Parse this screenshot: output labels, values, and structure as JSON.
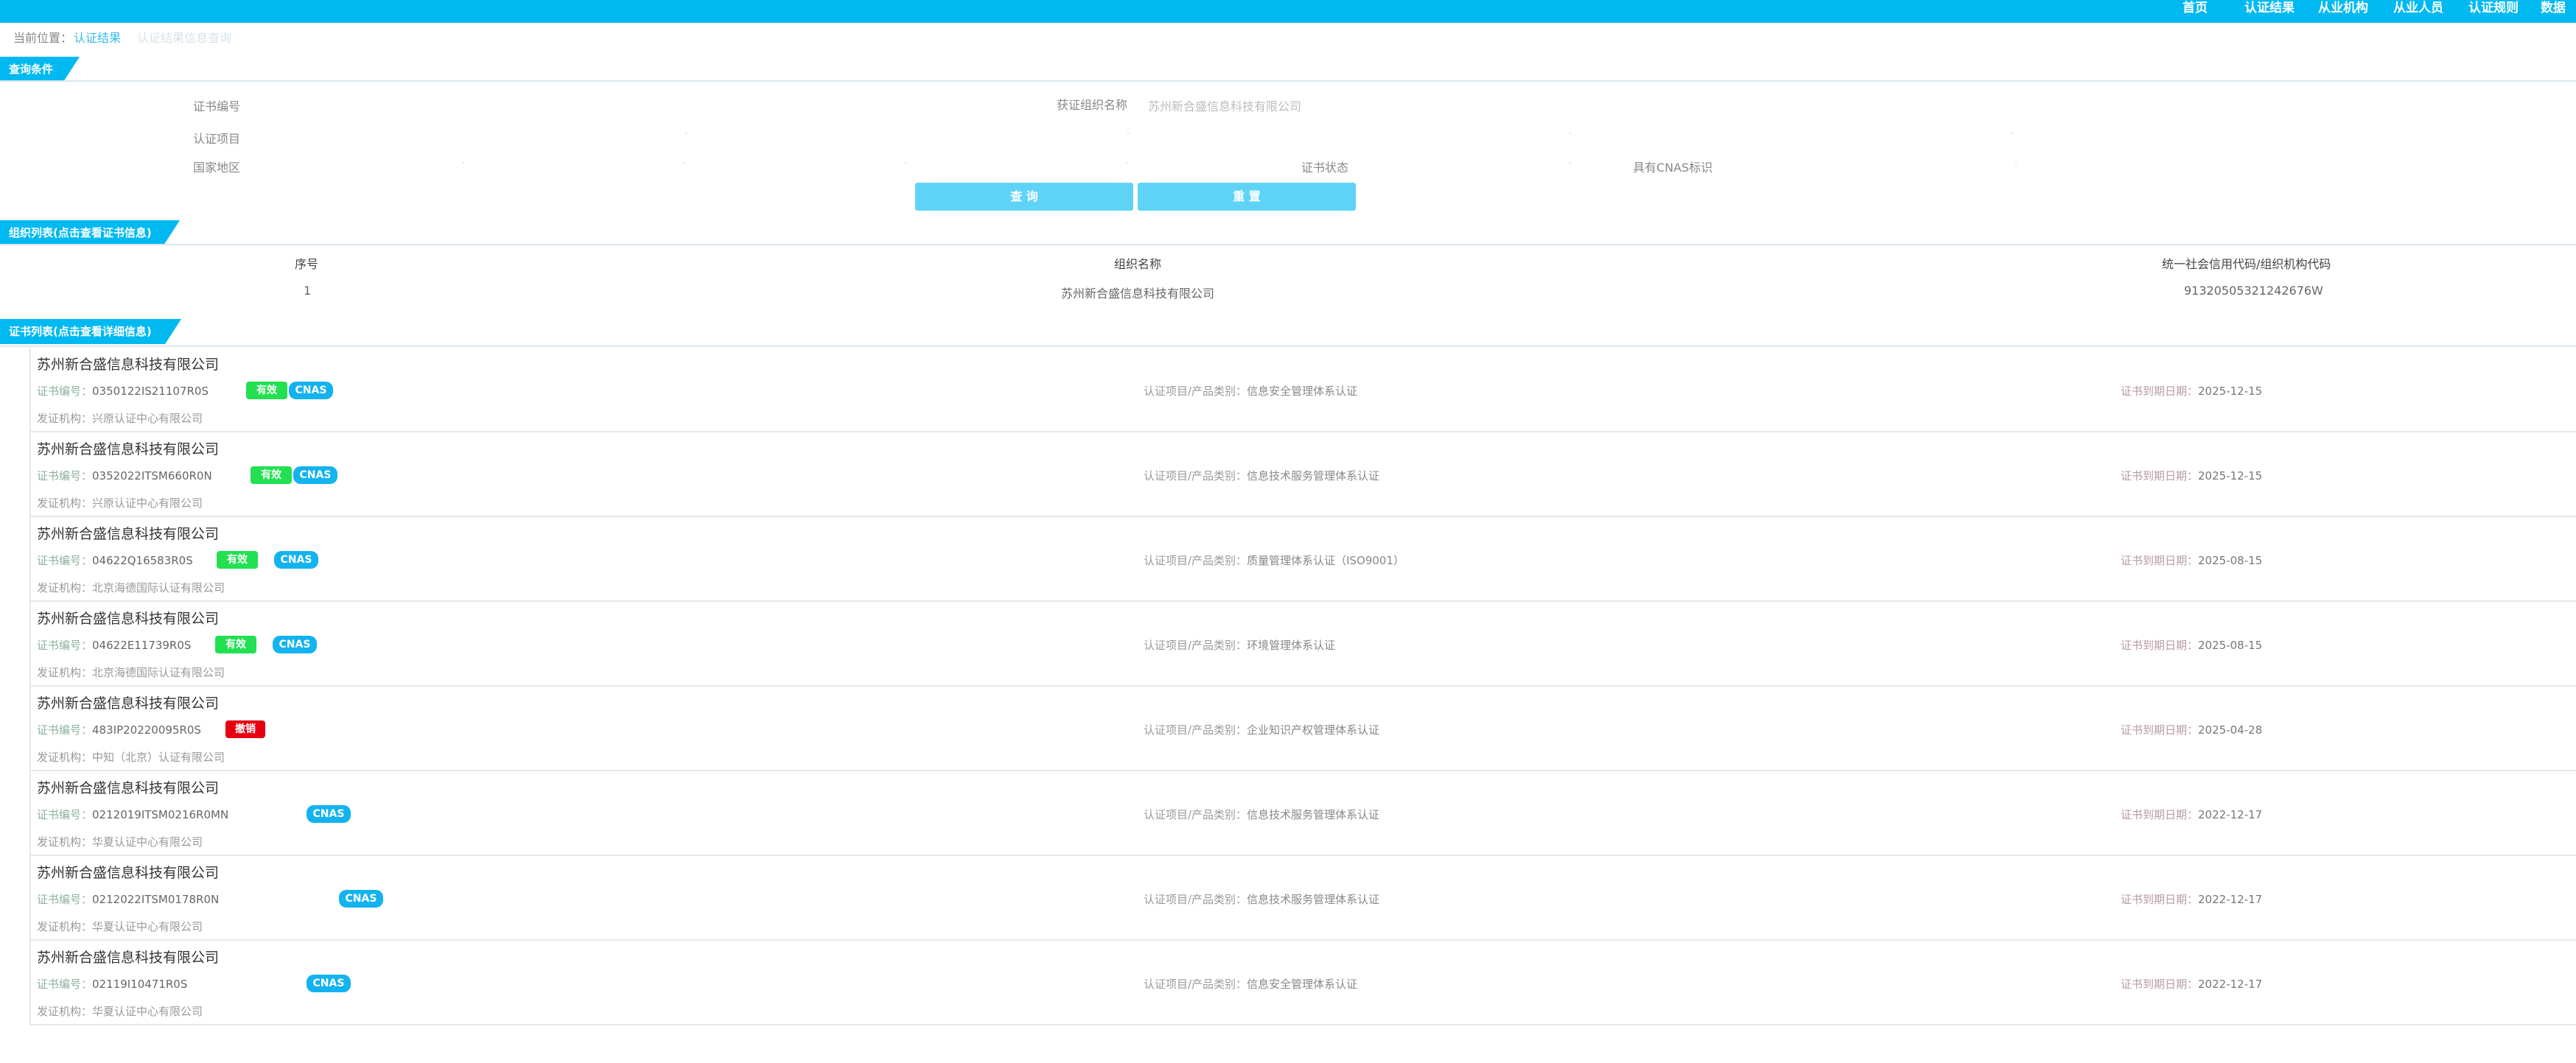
{
  "nav": {
    "items": [
      "首页",
      "认证结果",
      "从业机构",
      "从业人员",
      "认证规则",
      "数据"
    ]
  },
  "breadcrumb": {
    "prefix": "当前位置：",
    "current": "认证结果",
    "sub": "认证结果信息查询"
  },
  "query": {
    "header": "查询条件",
    "cert_no_label": "证书编号",
    "org_name_label": "获证组织名称",
    "org_name_value": "苏州新合盛信息科技有限公司",
    "project_label": "认证项目",
    "region_label": "国家地区",
    "status_label": "证书状态",
    "cnas_label": "具有CNAS标识",
    "search_button": "查 询",
    "reset_button": "重 置"
  },
  "org_list": {
    "header": "组织列表(点击查看证书信息)",
    "columns": [
      "序号",
      "组织名称",
      "统一社会信用代码/组织机构代码"
    ],
    "rows": [
      {
        "index": "1",
        "name": "苏州新合盛信息科技有限公司",
        "code": "91320505321242676W"
      }
    ]
  },
  "cert_list": {
    "header": "证书列表(点击查看详细信息)",
    "labels": {
      "cert_no": "证书编号：",
      "project": "认证项目/产品类别：",
      "expiry": "证书到期日期：",
      "issuer": "发证机构："
    },
    "items": [
      {
        "org": "苏州新合盛信息科技有限公司",
        "cert_no": "0350122IS21107R0S",
        "status": "有效",
        "cnas": "CNAS",
        "project": "信息安全管理体系认证",
        "expiry": "2025-12-15",
        "issuer": "兴原认证中心有限公司"
      },
      {
        "org": "苏州新合盛信息科技有限公司",
        "cert_no": "0352022ITSM660R0N",
        "status": "有效",
        "cnas": "CNAS",
        "project": "信息技术服务管理体系认证",
        "expiry": "2025-12-15",
        "issuer": "兴原认证中心有限公司"
      },
      {
        "org": "苏州新合盛信息科技有限公司",
        "cert_no": "04622Q16583R0S",
        "status": "有效",
        "cnas": "CNAS",
        "project": "质量管理体系认证（ISO9001）",
        "expiry": "2025-08-15",
        "issuer": "北京海德国际认证有限公司"
      },
      {
        "org": "苏州新合盛信息科技有限公司",
        "cert_no": "04622E11739R0S",
        "status": "有效",
        "cnas": "CNAS",
        "project": "环境管理体系认证",
        "expiry": "2025-08-15",
        "issuer": "北京海德国际认证有限公司"
      },
      {
        "org": "苏州新合盛信息科技有限公司",
        "cert_no": "483IP20220095R0S",
        "status": "撤销",
        "cnas": "",
        "project": "企业知识产权管理体系认证",
        "expiry": "2025-04-28",
        "issuer": "中知（北京）认证有限公司"
      },
      {
        "org": "苏州新合盛信息科技有限公司",
        "cert_no": "0212019ITSM0216R0MN",
        "status": "",
        "cnas": "CNAS",
        "project": "信息技术服务管理体系认证",
        "expiry": "2022-12-17",
        "issuer": "华夏认证中心有限公司"
      },
      {
        "org": "苏州新合盛信息科技有限公司",
        "cert_no": "0212022ITSM0178R0N",
        "status": "",
        "cnas": "CNAS",
        "project": "信息技术服务管理体系认证",
        "expiry": "2022-12-17",
        "issuer": "华夏认证中心有限公司"
      },
      {
        "org": "苏州新合盛信息科技有限公司",
        "cert_no": "02119I10471R0S",
        "status": "",
        "cnas": "CNAS",
        "project": "信息安全管理体系认证",
        "expiry": "2022-12-17",
        "issuer": "华夏认证中心有限公司"
      }
    ]
  },
  "colors": {
    "brand": "#00b9f1",
    "button": "#5fd3f6",
    "valid_badge": "#22e052",
    "revoked_badge": "#e60012",
    "cnas_badge": "#13b3ef"
  }
}
